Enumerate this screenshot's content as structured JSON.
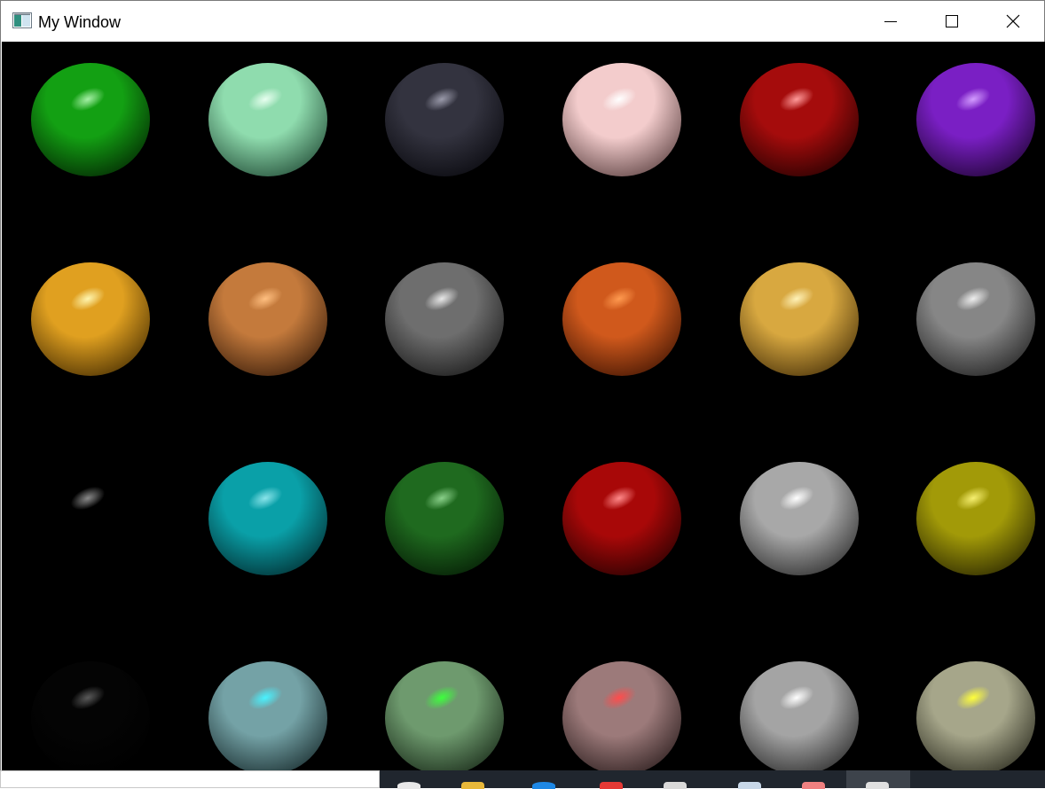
{
  "window": {
    "title": "My Window",
    "controls": {
      "minimize": "minimize-icon",
      "maximize": "maximize-icon",
      "close": "close-icon"
    }
  },
  "spheres": [
    [
      {
        "base": "#13a013",
        "dark": "#053305",
        "hl": "#a6f0a6"
      },
      {
        "base": "#8fdcae",
        "dark": "#2f5d45",
        "hl": "#e8fff0"
      },
      {
        "base": "#33333f",
        "dark": "#0e0e14",
        "hl": "#9a9aaa"
      },
      {
        "base": "#f3cccc",
        "dark": "#6e5252",
        "hl": "#ffffff"
      },
      {
        "base": "#a50c0c",
        "dark": "#330202",
        "hl": "#ff9a9a"
      },
      {
        "base": "#7a1fc4",
        "dark": "#2a0845",
        "hl": "#d39cff"
      }
    ],
    [
      {
        "base": "#e0a020",
        "dark": "#5a3c06",
        "hl": "#fff6b0"
      },
      {
        "base": "#c47a3c",
        "dark": "#4a2810",
        "hl": "#ffbf80"
      },
      {
        "base": "#6e6e6e",
        "dark": "#242424",
        "hl": "#e8e8e8"
      },
      {
        "base": "#d0591c",
        "dark": "#521d06",
        "hl": "#ff9a50"
      },
      {
        "base": "#d8a840",
        "dark": "#5a4010",
        "hl": "#fff2b8"
      },
      {
        "base": "#868686",
        "dark": "#2e2e2e",
        "hl": "#eeeeee"
      }
    ],
    [
      {
        "base": "#000000",
        "dark": "#000000",
        "hl": "#8a8a8a"
      },
      {
        "base": "#0aa0a8",
        "dark": "#033a3e",
        "hl": "#8ae4ea"
      },
      {
        "base": "#1f6a1f",
        "dark": "#082408",
        "hl": "#8ad08a"
      },
      {
        "base": "#a80808",
        "dark": "#350202",
        "hl": "#ff8a8a"
      },
      {
        "base": "#a8a8a8",
        "dark": "#3c3c3c",
        "hl": "#ffffff"
      },
      {
        "base": "#a29a08",
        "dark": "#383402",
        "hl": "#f6ef70"
      }
    ],
    [
      {
        "base": "#040404",
        "dark": "#000000",
        "hl": "#5a5a5a"
      },
      {
        "base": "#74a2a6",
        "dark": "#23393b",
        "hl": "#48f2ff"
      },
      {
        "base": "#6e9a6e",
        "dark": "#223622",
        "hl": "#3dff3d"
      },
      {
        "base": "#9c7a7a",
        "dark": "#382828",
        "hl": "#ff4c4c"
      },
      {
        "base": "#a4a4a4",
        "dark": "#383838",
        "hl": "#ffffff"
      },
      {
        "base": "#a6a68a",
        "dark": "#3a3a2c",
        "hl": "#ffff3a"
      }
    ]
  ]
}
